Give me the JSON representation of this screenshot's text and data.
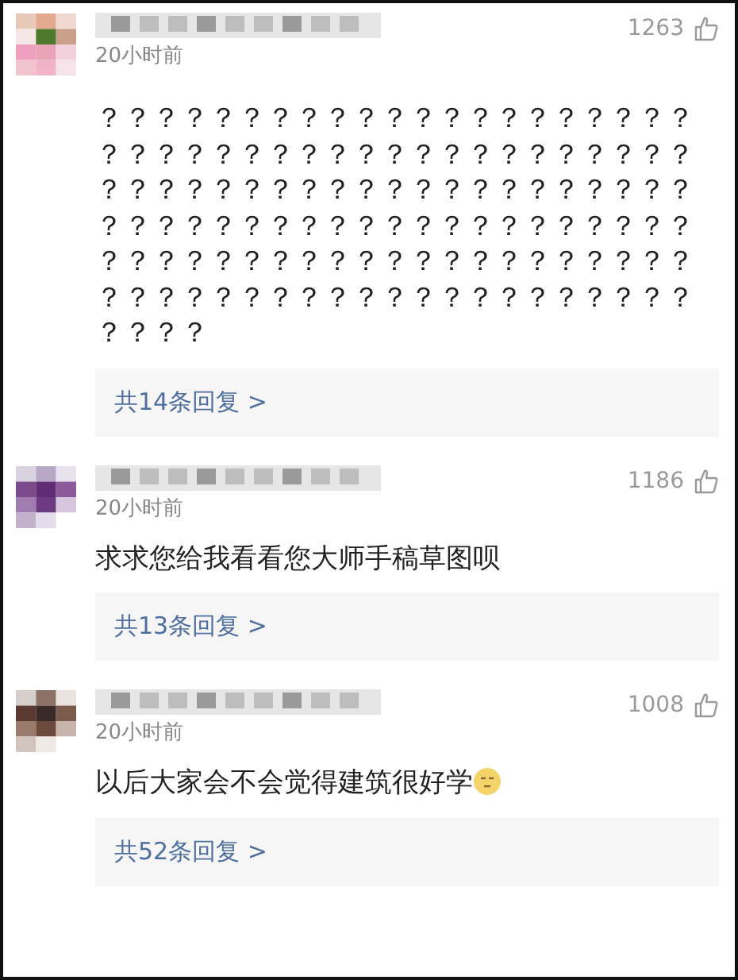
{
  "comments": [
    {
      "kind": "picture",
      "time": "20小时前",
      "likes": "1263",
      "text": "？？？？？？？？？？？？？？？？？？？？？？？？？？？？？？？？？？？？？？？？？？？？？？？？？？？？？？？？？？？？？？？？？？？？？？？？？？？？？？？？？？？？？？？？？？？？？？？？？？？？？？？？？？？？？？？？？？？？？？？？？？？？？？？？？？",
      "emoji": false,
      "replies": "共14条回复 >"
    },
    {
      "kind": "picture",
      "time": "20小时前",
      "likes": "1186",
      "text": "求求您给我看看您大师手稿草图呗",
      "emoji": false,
      "replies": "共13条回复 >"
    },
    {
      "kind": "picture",
      "time": "20小时前",
      "likes": "1008",
      "text": "以后大家会不会觉得建筑很好学",
      "emoji": true,
      "replies": "共52条回复 >"
    }
  ]
}
